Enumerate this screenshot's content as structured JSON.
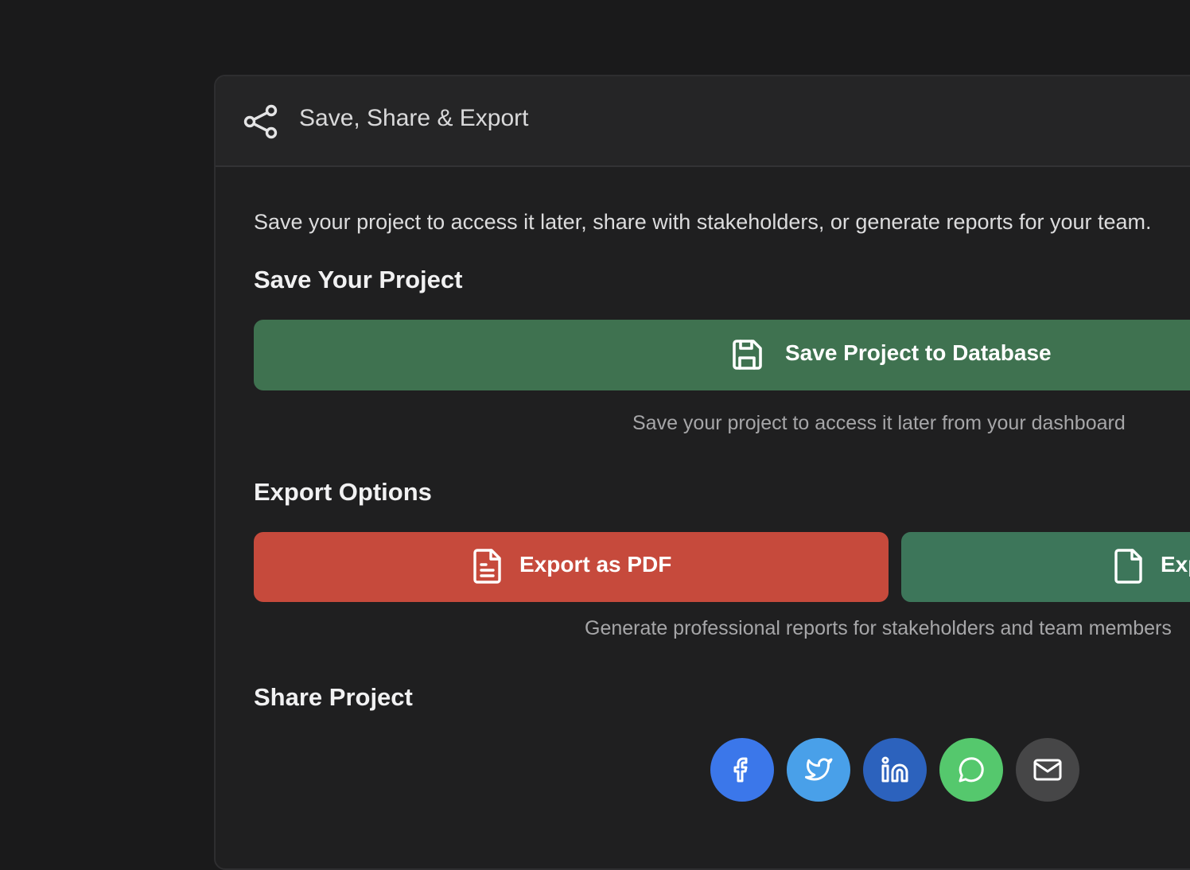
{
  "panel": {
    "title": "Save, Share & Export",
    "header_icon": "share-icon"
  },
  "intro": "Save your project to access it later, share with stakeholders, or generate reports for your team.",
  "save_section": {
    "title": "Save Your Project",
    "button_label": "Save Project to Database",
    "button_icon": "save-icon",
    "hint": "Save your project to access it later from your dashboard"
  },
  "export_section": {
    "title": "Export Options",
    "pdf_label": "Export as PDF",
    "pdf_icon": "file-text-icon",
    "second_label": "Export",
    "second_icon": "file-icon",
    "hint": "Generate professional reports for stakeholders and team members"
  },
  "share_section": {
    "title": "Share Project",
    "buttons": [
      {
        "icon": "facebook-icon",
        "color": "#3b77ea"
      },
      {
        "icon": "twitter-icon",
        "color": "#49a0e9"
      },
      {
        "icon": "linkedin-icon",
        "color": "#2c62bd"
      },
      {
        "icon": "whatsapp-icon",
        "color": "#55c86d"
      },
      {
        "icon": "email-icon",
        "color": "#464647"
      }
    ]
  },
  "colors": {
    "background": "#1a1a1b",
    "panel": "#1f1f20",
    "save_green": "#3f7250",
    "pdf_red": "#c64a3c",
    "export_green": "#3d765a"
  }
}
